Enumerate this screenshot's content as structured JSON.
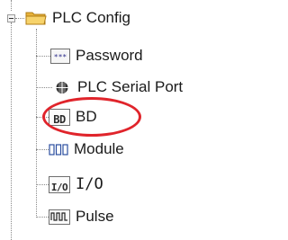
{
  "tree": {
    "root": {
      "label": "PLC Config",
      "icon": "folder-icon",
      "expanded": true
    },
    "items": [
      {
        "label": "Password",
        "icon": "password-icon"
      },
      {
        "label": "PLC Serial Port",
        "icon": "serial-port-icon"
      },
      {
        "label": "BD",
        "icon": "bd-icon",
        "icon_text": "BD",
        "highlighted": true
      },
      {
        "label": "Module",
        "icon": "module-icon"
      },
      {
        "label": "I/O",
        "icon": "io-icon",
        "icon_text": "I/O"
      },
      {
        "label": "Pulse",
        "icon": "pulse-icon"
      }
    ]
  },
  "colors": {
    "highlight": "#e0242b",
    "folder": "#f2c14e",
    "connector": "#8a8a8a"
  }
}
